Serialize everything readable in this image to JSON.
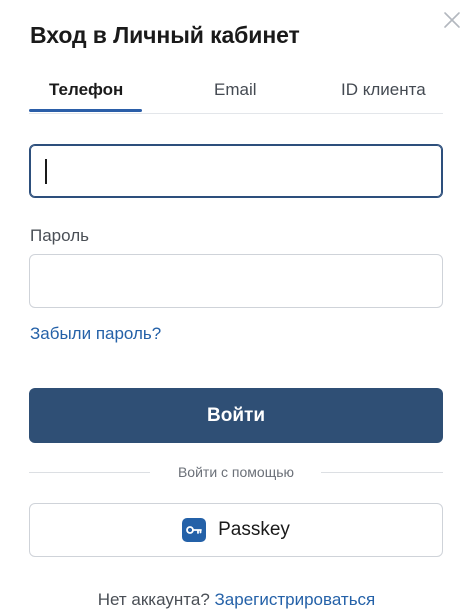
{
  "modal": {
    "title": "Вход в Личный кабинет",
    "close_icon": "close-icon"
  },
  "tabs": [
    {
      "label": "Телефон",
      "active": true
    },
    {
      "label": "Email",
      "active": false
    },
    {
      "label": "ID клиента",
      "active": false
    }
  ],
  "form": {
    "phone_value": "",
    "password_label": "Пароль",
    "password_value": "",
    "forgot_link": "Забыли пароль?",
    "submit_label": "Войти"
  },
  "alt_login": {
    "divider_text": "Войти с помощью",
    "passkey_label": "Passkey",
    "passkey_icon": "key-icon"
  },
  "footer": {
    "text": "Нет аккаунта?",
    "register_link": "Зарегистрироваться"
  },
  "colors": {
    "accent": "#2461a8",
    "primary_button": "#2f4f75",
    "tab_underline": "#2b5ea8"
  }
}
